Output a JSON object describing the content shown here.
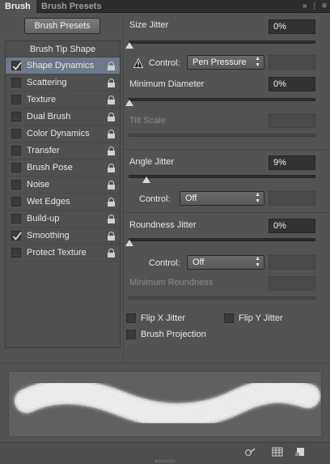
{
  "tabs": {
    "active": "Brush",
    "inactive": "Brush Presets"
  },
  "header_icons": {
    "collapse": "»",
    "menu": "≡"
  },
  "presets_button": "Brush Presets",
  "brush_tip_shape": "Brush Tip Shape",
  "options": [
    {
      "label": "Shape Dynamics",
      "checked": true,
      "selected": true
    },
    {
      "label": "Scattering",
      "checked": false
    },
    {
      "label": "Texture",
      "checked": false
    },
    {
      "label": "Dual Brush",
      "checked": false
    },
    {
      "label": "Color Dynamics",
      "checked": false
    },
    {
      "label": "Transfer",
      "checked": false
    },
    {
      "label": "Brush Pose",
      "checked": false
    },
    {
      "label": "Noise",
      "checked": false
    },
    {
      "label": "Wet Edges",
      "checked": false
    },
    {
      "label": "Build-up",
      "checked": false
    },
    {
      "label": "Smoothing",
      "checked": true
    },
    {
      "label": "Protect Texture",
      "checked": false
    }
  ],
  "size_jitter": {
    "label": "Size Jitter",
    "value": "0%",
    "level": 0
  },
  "size_control": {
    "label": "Control:",
    "value": "Pen Pressure"
  },
  "min_diameter": {
    "label": "Minimum Diameter",
    "value": "0%",
    "level": 0
  },
  "tilt_scale": {
    "label": "Tilt Scale"
  },
  "angle_jitter": {
    "label": "Angle Jitter",
    "value": "9%",
    "level": 0.09
  },
  "angle_control": {
    "label": "Control:",
    "value": "Off"
  },
  "roundness_jitter": {
    "label": "Roundness Jitter",
    "value": "0%",
    "level": 0
  },
  "roundness_control": {
    "label": "Control:",
    "value": "Off"
  },
  "min_roundness": {
    "label": "Minimum Roundness"
  },
  "checkboxes": {
    "flip_x": "Flip X Jitter",
    "flip_y": "Flip Y Jitter",
    "projection": "Brush Projection"
  },
  "colors": {
    "selected_row": "#6e7a89",
    "panel_bg": "#535353"
  }
}
